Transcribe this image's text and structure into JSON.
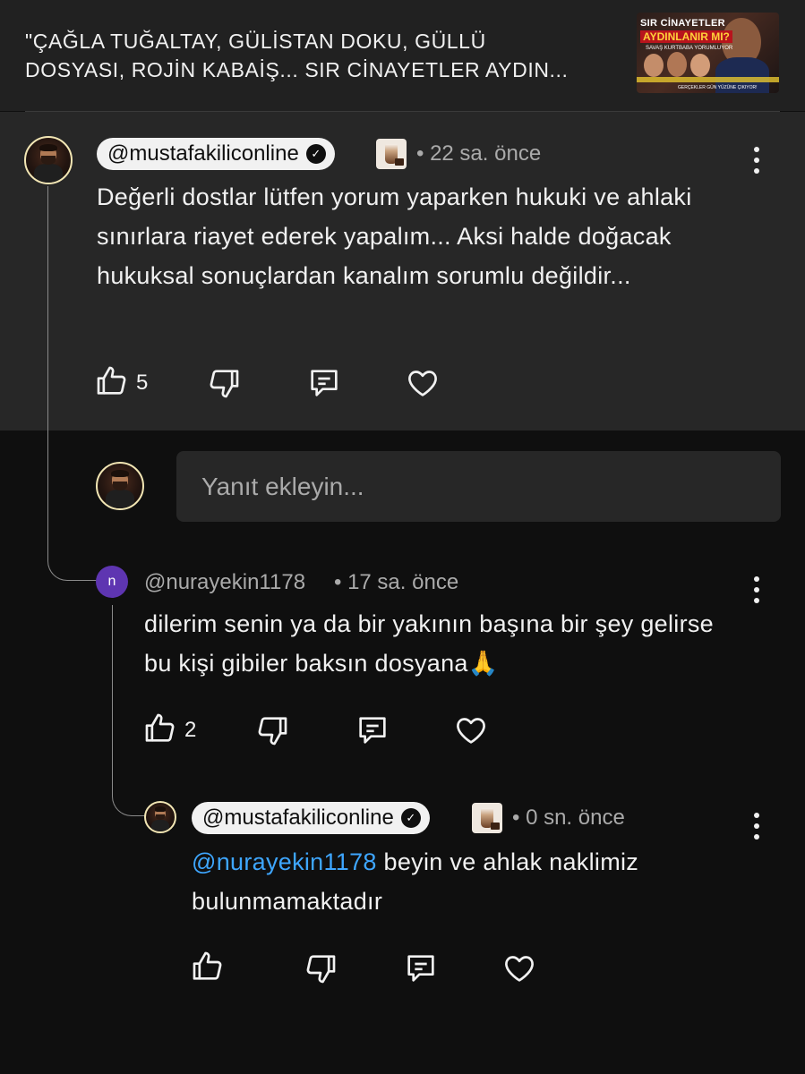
{
  "video": {
    "title": "\"ÇAĞLA TUĞALTAY, GÜLİSTAN DOKU, GÜLLÜ\nDOSYASI, ROJİN KABAİŞ... SIR CİNAYETLER AYDIN...",
    "thumbnail": {
      "line1": "SIR CİNAYETLER",
      "line2": "AYDINLANIR MI?",
      "line3": "SAVAŞ KURTBABA YORUMLUYOR",
      "line4": "GERÇEKLER GÜN YÜZÜNE ÇIKIYOR!"
    }
  },
  "pinned_comment": {
    "handle": "@mustafakiliconline",
    "verified_icon": "✓",
    "time": "• 22 sa. önce",
    "text": "Değerli dostlar lütfen yorum yaparken hukuki ve ahlaki sınırlara riayet ederek yapalım... Aksi halde doğacak hukuksal sonuçlardan kanalım sorumlu değildir...",
    "likes": "5"
  },
  "reply_input": {
    "placeholder": "Yanıt ekleyin..."
  },
  "reply1": {
    "avatar_letter": "n",
    "handle": "@nurayekin1178",
    "time": "• 17 sa. önce",
    "text": "dilerim senin ya da bir yakının başına bir şey gelirse bu kişi gibiler baksın dosyana",
    "emoji": "🙏",
    "likes": "2"
  },
  "reply2": {
    "handle": "@mustafakiliconline",
    "verified_icon": "✓",
    "time": "• 0 sn. önce",
    "mention": "@nurayekin1178",
    "text": " beyin ve ahlak naklimiz bulunmamaktadır"
  },
  "icons": [
    "like-icon",
    "dislike-icon",
    "reply-icon",
    "heart-icon",
    "more-options-icon",
    "verified-icon"
  ],
  "colors": {
    "background": "#0f0f0f",
    "pinned_background": "#272727",
    "mention": "#3ea6ff",
    "avatar_letter_bg": "#5e35b1"
  }
}
